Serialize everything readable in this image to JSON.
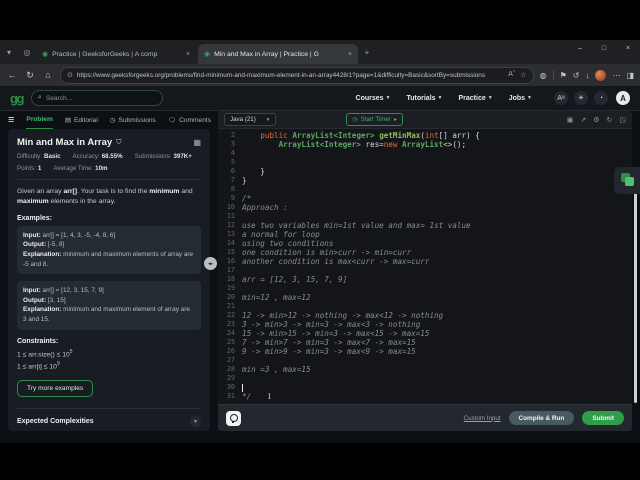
{
  "browser": {
    "tab_search_icon": "chevron-down-icon",
    "tabs": [
      {
        "title": "Practice | GeeksforGeeks | A comp",
        "active": false
      },
      {
        "title": "Min and Max in Array | Practice | G",
        "active": true
      }
    ],
    "new_tab_label": "+",
    "window_controls": [
      {
        "name": "minimize-button",
        "glyph": "–"
      },
      {
        "name": "maximize-button",
        "glyph": "□"
      },
      {
        "name": "close-button",
        "glyph": "×"
      }
    ],
    "nav_icons": [
      {
        "name": "back-icon",
        "glyph": "←"
      },
      {
        "name": "refresh-icon",
        "glyph": "↻"
      },
      {
        "name": "home-icon",
        "glyph": "⌂"
      }
    ],
    "url": "https://www.geeksforgeeks.org/problems/find-minimum-and-maximum-element-in-an-array4428/1?page=1&difficulty=Basic&sortBy=submissions",
    "url_pill_icons": [
      {
        "name": "read-aloud-icon",
        "glyph": "Aˆ"
      },
      {
        "name": "bookmark-star-icon",
        "glyph": "☆"
      }
    ],
    "toolbar_right_icons": [
      {
        "name": "extensions-icon",
        "glyph": "◍"
      },
      {
        "name": "separator",
        "glyph": ""
      },
      {
        "name": "flag-icon",
        "glyph": "⚑"
      },
      {
        "name": "history-icon",
        "glyph": "↺"
      },
      {
        "name": "download-icon",
        "glyph": "↓"
      },
      {
        "name": "profile-avatar",
        "glyph": ""
      },
      {
        "name": "more-menu-icon",
        "glyph": "⋯"
      },
      {
        "name": "sidebar-icon",
        "glyph": "◨"
      }
    ]
  },
  "navbar": {
    "logo": "gg",
    "search_placeholder": "Search...",
    "items": [
      {
        "label": "Courses"
      },
      {
        "label": "Tutorials"
      },
      {
        "label": "Practice"
      },
      {
        "label": "Jobs"
      }
    ],
    "right_icons": [
      {
        "name": "translate-icon",
        "glyph": "Aᵃ"
      },
      {
        "name": "theme-icon",
        "glyph": "☀"
      },
      {
        "name": "notifications-bell-icon",
        "glyph": "◔"
      }
    ],
    "avatar_letter": "A"
  },
  "problem_panel": {
    "tabs": [
      {
        "label": "Problem",
        "icon": "",
        "active": true
      },
      {
        "label": "Editorial",
        "icon": "▤",
        "active": false
      },
      {
        "label": "Submissions",
        "icon": "◷",
        "active": false
      },
      {
        "label": "Comments",
        "icon": "🗨",
        "active": false
      }
    ],
    "title": "Min and Max in Array",
    "bookmark_icon": "⛉",
    "stats_row1": [
      {
        "label": "Difficulty:",
        "value": "Basic"
      },
      {
        "label": "Accuracy:",
        "value": "68.55%"
      },
      {
        "label": "Submissions:",
        "value": "397K+"
      }
    ],
    "stats_row2": [
      {
        "label": "Points:",
        "value": "1"
      },
      {
        "label": "Average Time:",
        "value": "10m"
      }
    ],
    "description_segments": [
      [
        "r",
        "Given an array "
      ],
      [
        "b",
        "arr[]"
      ],
      [
        "r",
        ". Your task is to find the "
      ],
      [
        "b",
        "minimum"
      ],
      [
        "r",
        " and "
      ],
      [
        "b",
        "maximum"
      ],
      [
        "r",
        " elements in the array."
      ]
    ],
    "examples_heading": "Examples:",
    "examples": [
      {
        "input_label": "Input:",
        "input": "arr[] = [1, 4, 3, -5, -4, 8, 6]",
        "output_label": "Output:",
        "output": "[-5, 8]",
        "explanation_label": "Explanation:",
        "explanation": "minimum and maximum elements of array are -5 and 8."
      },
      {
        "input_label": "Input:",
        "input": "arr[] = [12, 3, 15, 7, 9]",
        "output_label": "Output:",
        "output": "[3, 15]",
        "explanation_label": "Explanation:",
        "explanation": "minimum and maximum element of array are 3 and 15."
      }
    ],
    "constraints_heading": "Constraints:",
    "constraints": [
      {
        "base": "1 ≤ arr.size() ≤ 10",
        "exp": "5"
      },
      {
        "base": "1 ≤ arr[i] ≤ 10",
        "exp": "9"
      }
    ],
    "try_examples_button": "Try more examples",
    "expected_complexities": "Expected Complexities"
  },
  "editor": {
    "language_selector": "Java (21)",
    "start_timer_label": "Start Timer",
    "header_icons": [
      {
        "name": "copy-icon",
        "glyph": "▣"
      },
      {
        "name": "share-icon",
        "glyph": "↗"
      },
      {
        "name": "settings-gear-icon",
        "glyph": "⚙"
      },
      {
        "name": "reset-code-icon",
        "glyph": "↻"
      },
      {
        "name": "fullscreen-icon",
        "glyph": "◳"
      }
    ],
    "cursor_line": 30,
    "code_lines": [
      {
        "n": 2,
        "tokens": [
          [
            "pl",
            "    "
          ],
          [
            "kw",
            "public "
          ],
          [
            "ty",
            "ArrayList<Integer>"
          ],
          [
            "pl",
            " "
          ],
          [
            "fn",
            "getMinMax"
          ],
          [
            "pl",
            "("
          ],
          [
            "kw",
            "int"
          ],
          [
            "pl",
            "[] arr) {"
          ]
        ]
      },
      {
        "n": 3,
        "tokens": [
          [
            "pl",
            "        "
          ],
          [
            "ty",
            "ArrayList<Integer>"
          ],
          [
            "pl",
            " res="
          ],
          [
            "kw",
            "new"
          ],
          [
            "pl",
            " "
          ],
          [
            "ty",
            "ArrayList"
          ],
          [
            "pl",
            "<>();"
          ]
        ]
      },
      {
        "n": 4,
        "tokens": []
      },
      {
        "n": 5,
        "tokens": []
      },
      {
        "n": 6,
        "tokens": [
          [
            "pl",
            "    }"
          ]
        ]
      },
      {
        "n": 7,
        "tokens": [
          [
            "pl",
            "}"
          ]
        ]
      },
      {
        "n": 8,
        "tokens": []
      },
      {
        "n": 9,
        "tokens": [
          [
            "cm",
            "/*"
          ]
        ]
      },
      {
        "n": 10,
        "tokens": [
          [
            "cm",
            "Approach :"
          ]
        ]
      },
      {
        "n": 11,
        "tokens": []
      },
      {
        "n": 12,
        "tokens": [
          [
            "cm",
            "use two variables min=1st value and max= 1st value"
          ]
        ]
      },
      {
        "n": 13,
        "tokens": [
          [
            "cm",
            "a normal for loop"
          ]
        ]
      },
      {
        "n": 14,
        "tokens": [
          [
            "cm",
            "using two conditions"
          ]
        ]
      },
      {
        "n": 15,
        "tokens": [
          [
            "cm",
            "one condition is min>curr -> min=curr"
          ]
        ]
      },
      {
        "n": 16,
        "tokens": [
          [
            "cm",
            "another condition is max<curr -> max=curr"
          ]
        ]
      },
      {
        "n": 17,
        "tokens": []
      },
      {
        "n": 18,
        "tokens": [
          [
            "cm",
            "arr = [12, 3, 15, 7, 9]"
          ]
        ]
      },
      {
        "n": 19,
        "tokens": []
      },
      {
        "n": 20,
        "tokens": [
          [
            "cm",
            "min=12 , max=12"
          ]
        ]
      },
      {
        "n": 21,
        "tokens": []
      },
      {
        "n": 22,
        "tokens": [
          [
            "cm",
            "12 -> min>12 -> nothing -> max<12 -> nothing"
          ]
        ]
      },
      {
        "n": 23,
        "tokens": [
          [
            "cm",
            "3 -> min>3 -> min=3 -> max<3 -> nothing"
          ]
        ]
      },
      {
        "n": 24,
        "tokens": [
          [
            "cm",
            "15 -> min>15 -> min=3 -> max<15 -> max=15"
          ]
        ]
      },
      {
        "n": 25,
        "tokens": [
          [
            "cm",
            "7 -> min>7 -> min=3 -> max<7 -> max=15"
          ]
        ]
      },
      {
        "n": 26,
        "tokens": [
          [
            "cm",
            "9 -> min>9 -> min=3 -> max<9 -> max=15"
          ]
        ]
      },
      {
        "n": 27,
        "tokens": []
      },
      {
        "n": 28,
        "tokens": [
          [
            "cm",
            "min =3 , max=15"
          ]
        ]
      },
      {
        "n": 29,
        "tokens": []
      },
      {
        "n": 30,
        "tokens": []
      },
      {
        "n": 31,
        "tokens": [
          [
            "cm",
            "*/"
          ]
        ]
      }
    ]
  },
  "footer": {
    "custom_input": "Custom Input",
    "compile_run": "Compile & Run",
    "submit": "Submit"
  },
  "colors": {
    "brand_green": "#2f8d46",
    "submit_green": "#2f9e49",
    "compile_slate": "#465a61",
    "page_bg": "#0c1014",
    "card_bg": "#181d23",
    "example_bg": "#252b32",
    "editor_bg": "#141519",
    "keyword_orange": "#e0703f",
    "type_green": "#5da862",
    "comment_gray": "#878d94"
  }
}
